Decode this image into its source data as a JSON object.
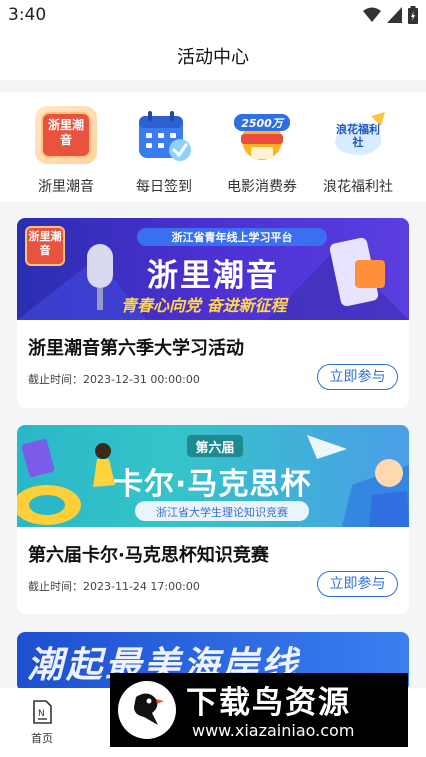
{
  "status_bar": {
    "time": "3:40"
  },
  "nav": {
    "title": "活动中心"
  },
  "quick_actions": [
    {
      "label": "浙里潮音",
      "icon": "zheli-chaoyin-icon",
      "icon_text": "浙里潮音"
    },
    {
      "label": "每日签到",
      "icon": "calendar-check-icon"
    },
    {
      "label": "电影消费券",
      "icon": "movie-coupon-icon",
      "icon_text": "2500万"
    },
    {
      "label": "浪花福利社",
      "icon": "langhua-welfare-icon",
      "icon_text": "浪花福利社"
    }
  ],
  "activities": [
    {
      "banner": {
        "badge": "浙里潮音",
        "platform": "浙江省青年线上学习平台",
        "headline": "浙里潮音",
        "slogan": "青春心向党 奋进新征程"
      },
      "title": "浙里潮音第六季大学习活动",
      "deadline": "截止时间：2023-12-31 00:00:00",
      "button": "立即参与"
    },
    {
      "banner": {
        "edition": "第六届",
        "headline": "卡尔·马克思杯",
        "subtitle": "浙江省大学生理论知识竞赛"
      },
      "title": "第六届卡尔·马克思杯知识竞赛",
      "deadline": "截止时间：2023-11-24 17:00:00",
      "button": "立即参与"
    },
    {
      "banner": {
        "headline": "潮起最美海岸线"
      }
    }
  ],
  "tab_bar": {
    "home": "首页"
  },
  "watermark": {
    "title": "下载鸟资源",
    "url": "www.xiazainiao.com"
  },
  "colors": {
    "accent": "#2f6fe0",
    "background": "#f4f5f7"
  }
}
